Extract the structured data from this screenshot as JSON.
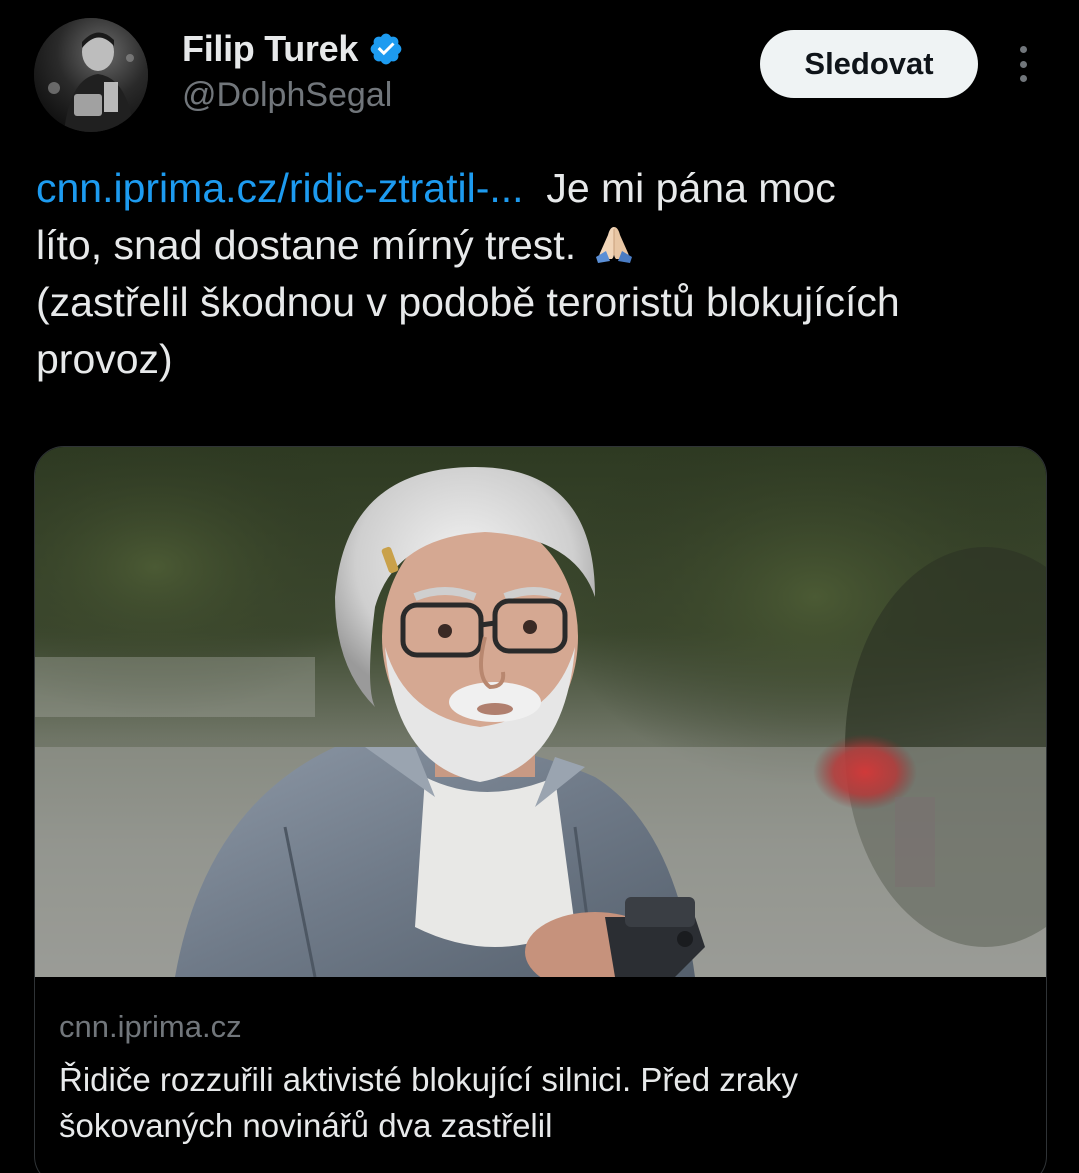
{
  "author": {
    "display_name": "Filip Turek",
    "handle": "@DolphSegal",
    "verified_icon": "verified-badge-icon",
    "verified_color": "#1d9bf0"
  },
  "actions": {
    "follow_label": "Sledovat",
    "more_icon": "more-vertical-icon"
  },
  "tweet": {
    "link_text": "cnn.iprima.cz/ridic-ztratil-...",
    "line1_rest": "Je mi pána moc",
    "line2": "líto, snad dostane mírný trest.",
    "emoji": "🙏",
    "line3": "(zastřelil škodnou v podobě teroristů blokujících",
    "line4": "provoz)",
    "link_color": "#1d9bf0"
  },
  "card": {
    "domain": "cnn.iprima.cz",
    "title_line1": "Řidiče rozzuřili aktivisté blokující silnici. Před zraky",
    "title_line2": "šokovaných novinářů dva zastřelil"
  }
}
